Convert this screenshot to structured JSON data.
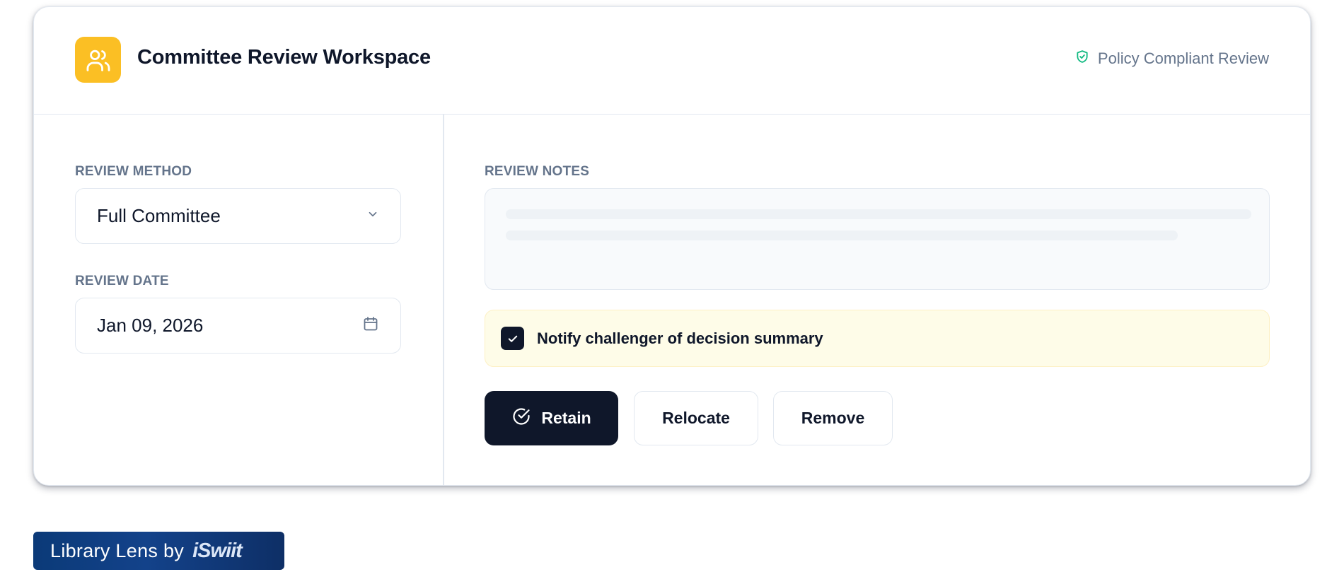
{
  "header": {
    "title": "Committee Review Workspace",
    "policy_label": "Policy Compliant Review",
    "icon": "users-icon",
    "accent_color": "#fbbf24"
  },
  "left": {
    "method_label": "REVIEW METHOD",
    "method_value": "Full Committee",
    "date_label": "REVIEW DATE",
    "date_value": "Jan 09, 2026"
  },
  "right": {
    "notes_label": "REVIEW NOTES",
    "notify_label": "Notify challenger of decision summary",
    "notify_checked": true
  },
  "actions": {
    "retain": "Retain",
    "relocate": "Relocate",
    "remove": "Remove"
  },
  "footer": {
    "brand_text": "Library Lens by",
    "brand_logo": "iSwiit"
  }
}
